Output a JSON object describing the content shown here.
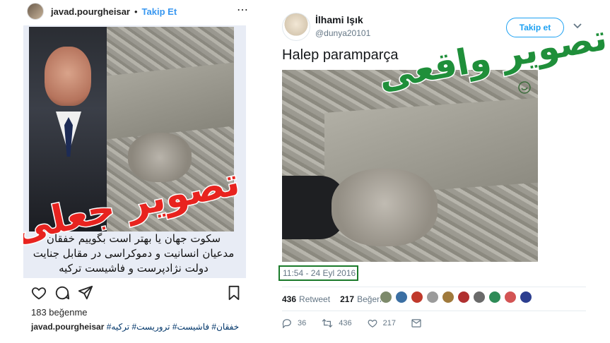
{
  "instagram": {
    "username": "javad.pourgheisar",
    "separator": "•",
    "follow_label": "Takip Et",
    "more_icon": "⋯",
    "overlay_label": "تصویر جعلی",
    "caption_lines": [
      "سکوت جهان یا بهتر است بگوییم خفقان",
      "مدعیان انسانیت و دموکراسی در مقابل جنایت",
      "دولت نژادپرست و فاشیست ترکیه"
    ],
    "likes_text": "183 beğenme",
    "bottom_username": "javad.pourgheisar",
    "bottom_tags": "#خفقان# فاشیست# تروریست# ترکیه"
  },
  "twitter": {
    "display_name": "İlhami Işık",
    "handle": "@dunya20101",
    "follow_label": "Takip et",
    "tweet_text": "Halep paramparça",
    "overlay_label": "تصویر واقعی",
    "timestamp": "11:54 - 24 Eyl 2016",
    "retweets_count": "436",
    "retweets_label": "Retweet",
    "likes_count": "217",
    "likes_label": "Beğeni",
    "likers": [
      "#7d8a6b",
      "#3b6fa3",
      "#c0392b",
      "#9b9b9b",
      "#a07a3c",
      "#b03030",
      "#6a6a6a",
      "#2e8b57",
      "#d35454",
      "#2c3e8f"
    ],
    "reply_count": "36",
    "retweet_action_count": "436",
    "like_action_count": "217",
    "accent_color": "#1da1f2"
  }
}
